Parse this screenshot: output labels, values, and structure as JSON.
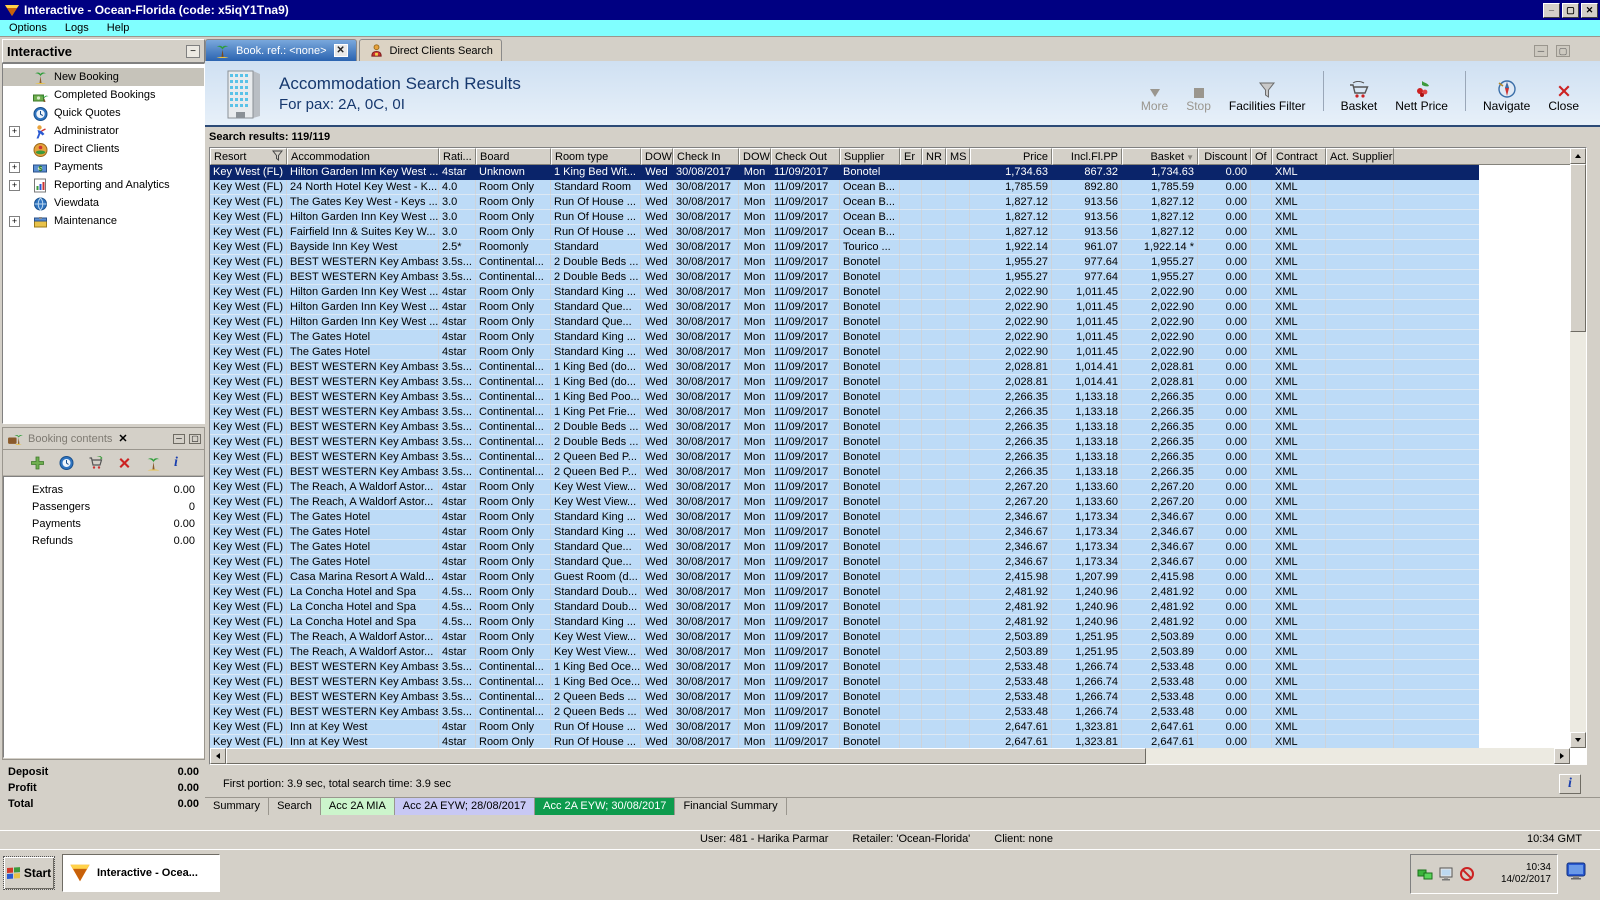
{
  "window": {
    "title": "Interactive - Ocean-Florida (code: x5iqY1Tna9)",
    "menus": [
      "Options",
      "Logs",
      "Help"
    ]
  },
  "sidebar": {
    "title": "Interactive",
    "items": [
      {
        "label": "New Booking",
        "icon": "palm-tree",
        "expandable": false,
        "selected": true
      },
      {
        "label": "Completed Bookings",
        "icon": "completed-bookings",
        "expandable": false,
        "selected": false
      },
      {
        "label": "Quick Quotes",
        "icon": "clock-globe",
        "expandable": false,
        "selected": false
      },
      {
        "label": "Administrator",
        "icon": "administrator",
        "expandable": true,
        "selected": false
      },
      {
        "label": "Direct Clients",
        "icon": "direct-clients",
        "expandable": false,
        "selected": false
      },
      {
        "label": "Payments",
        "icon": "payments",
        "expandable": true,
        "selected": false
      },
      {
        "label": "Reporting and Analytics",
        "icon": "report",
        "expandable": true,
        "selected": false
      },
      {
        "label": "Viewdata",
        "icon": "viewdata",
        "expandable": false,
        "selected": false
      },
      {
        "label": "Maintenance",
        "icon": "maintenance",
        "expandable": true,
        "selected": false
      }
    ]
  },
  "booking_contents": {
    "title": "Booking contents",
    "rows": [
      {
        "label": "Extras",
        "value": "0.00"
      },
      {
        "label": "Passengers",
        "value": "0"
      },
      {
        "label": "Payments",
        "value": "0.00"
      },
      {
        "label": "Refunds",
        "value": "0.00"
      }
    ]
  },
  "totals": [
    {
      "label": "Deposit",
      "value": "0.00"
    },
    {
      "label": "Profit",
      "value": "0.00"
    },
    {
      "label": "Total",
      "value": "0.00"
    }
  ],
  "tabs": [
    {
      "label": "Book. ref.: <none>",
      "active": true
    },
    {
      "label": "Direct Clients Search",
      "active": false
    }
  ],
  "header": {
    "title": "Accommodation Search Results",
    "subtitle": "For pax: 2A, 0C, 0I"
  },
  "toolbar": [
    {
      "label": "More",
      "disabled": true
    },
    {
      "label": "Stop",
      "disabled": true
    },
    {
      "label": "Facilities Filter",
      "disabled": false
    },
    {
      "label": "Basket",
      "disabled": false
    },
    {
      "label": "Nett Price",
      "disabled": false
    },
    {
      "label": "Navigate",
      "disabled": false
    },
    {
      "label": "Close",
      "disabled": false
    }
  ],
  "results": {
    "summary": "Search results: 119/119",
    "columns": [
      "Resort",
      "Accommodation",
      "Rati...",
      "Board",
      "Room type",
      "DOW",
      "Check In",
      "DOW",
      "Check Out",
      "Supplier",
      "Er",
      "NR",
      "MS",
      "Price",
      "Incl.Fl.PP",
      "Basket",
      "Discount",
      "Of",
      "Contract",
      "Act. Supplier"
    ],
    "row_defaults": {
      "resort": "Key West (FL)",
      "dow_in": "Wed",
      "check_in": "30/08/2017",
      "dow_out": "Mon",
      "check_out": "11/09/2017",
      "er": "",
      "nr": "",
      "ms": "",
      "discount": "0.00",
      "of": "",
      "contract": "XML",
      "act_supplier": ""
    },
    "selected_row": 0,
    "rows": [
      {
        "accommodation": "Hilton Garden Inn Key West ...",
        "rating": "4star",
        "board": "Unknown",
        "room_type": "1 King Bed Wit...",
        "supplier": "Bonotel",
        "price": "1,734.63",
        "incl_fl_pp": "867.32",
        "basket": "1,734.63"
      },
      {
        "accommodation": "24 North Hotel Key West - K...",
        "rating": "4.0",
        "board": "Room Only",
        "room_type": "Standard Room",
        "supplier": "Ocean B...",
        "price": "1,785.59",
        "incl_fl_pp": "892.80",
        "basket": "1,785.59"
      },
      {
        "accommodation": "The Gates Key West - Keys ...",
        "rating": "3.0",
        "board": "Room Only",
        "room_type": "Run Of House ...",
        "supplier": "Ocean B...",
        "price": "1,827.12",
        "incl_fl_pp": "913.56",
        "basket": "1,827.12"
      },
      {
        "accommodation": "Hilton Garden Inn Key West ...",
        "rating": "3.0",
        "board": "Room Only",
        "room_type": "Run Of House ...",
        "supplier": "Ocean B...",
        "price": "1,827.12",
        "incl_fl_pp": "913.56",
        "basket": "1,827.12"
      },
      {
        "accommodation": "Fairfield Inn & Suites Key W...",
        "rating": "3.0",
        "board": "Room Only",
        "room_type": "Run Of House ...",
        "supplier": "Ocean B...",
        "price": "1,827.12",
        "incl_fl_pp": "913.56",
        "basket": "1,827.12"
      },
      {
        "accommodation": "Bayside Inn Key West",
        "rating": "2.5*",
        "board": "Roomonly",
        "room_type": "Standard",
        "supplier": "Tourico ...",
        "price": "1,922.14",
        "incl_fl_pp": "961.07",
        "basket": "1,922.14 *"
      },
      {
        "accommodation": "BEST WESTERN Key Ambass...",
        "rating": "3.5s...",
        "board": "Continental...",
        "room_type": "2 Double Beds ...",
        "supplier": "Bonotel",
        "price": "1,955.27",
        "incl_fl_pp": "977.64",
        "basket": "1,955.27"
      },
      {
        "accommodation": "BEST WESTERN Key Ambass...",
        "rating": "3.5s...",
        "board": "Continental...",
        "room_type": "2 Double Beds ...",
        "supplier": "Bonotel",
        "price": "1,955.27",
        "incl_fl_pp": "977.64",
        "basket": "1,955.27"
      },
      {
        "accommodation": "Hilton Garden Inn Key West ...",
        "rating": "4star",
        "board": "Room Only",
        "room_type": "Standard King ...",
        "supplier": "Bonotel",
        "price": "2,022.90",
        "incl_fl_pp": "1,011.45",
        "basket": "2,022.90"
      },
      {
        "accommodation": "Hilton Garden Inn Key West ...",
        "rating": "4star",
        "board": "Room Only",
        "room_type": "Standard Que...",
        "supplier": "Bonotel",
        "price": "2,022.90",
        "incl_fl_pp": "1,011.45",
        "basket": "2,022.90"
      },
      {
        "accommodation": "Hilton Garden Inn Key West ...",
        "rating": "4star",
        "board": "Room Only",
        "room_type": "Standard Que...",
        "supplier": "Bonotel",
        "price": "2,022.90",
        "incl_fl_pp": "1,011.45",
        "basket": "2,022.90"
      },
      {
        "accommodation": "The Gates Hotel",
        "rating": "4star",
        "board": "Room Only",
        "room_type": "Standard King ...",
        "supplier": "Bonotel",
        "price": "2,022.90",
        "incl_fl_pp": "1,011.45",
        "basket": "2,022.90"
      },
      {
        "accommodation": "The Gates Hotel",
        "rating": "4star",
        "board": "Room Only",
        "room_type": "Standard King ...",
        "supplier": "Bonotel",
        "price": "2,022.90",
        "incl_fl_pp": "1,011.45",
        "basket": "2,022.90"
      },
      {
        "accommodation": "BEST WESTERN Key Ambass...",
        "rating": "3.5s...",
        "board": "Continental...",
        "room_type": "1 King Bed (do...",
        "supplier": "Bonotel",
        "price": "2,028.81",
        "incl_fl_pp": "1,014.41",
        "basket": "2,028.81"
      },
      {
        "accommodation": "BEST WESTERN Key Ambass...",
        "rating": "3.5s...",
        "board": "Continental...",
        "room_type": "1 King Bed (do...",
        "supplier": "Bonotel",
        "price": "2,028.81",
        "incl_fl_pp": "1,014.41",
        "basket": "2,028.81"
      },
      {
        "accommodation": "BEST WESTERN Key Ambass...",
        "rating": "3.5s...",
        "board": "Continental...",
        "room_type": "1 King Bed Poo...",
        "supplier": "Bonotel",
        "price": "2,266.35",
        "incl_fl_pp": "1,133.18",
        "basket": "2,266.35"
      },
      {
        "accommodation": "BEST WESTERN Key Ambass...",
        "rating": "3.5s...",
        "board": "Continental...",
        "room_type": "1 King Pet Frie...",
        "supplier": "Bonotel",
        "price": "2,266.35",
        "incl_fl_pp": "1,133.18",
        "basket": "2,266.35"
      },
      {
        "accommodation": "BEST WESTERN Key Ambass...",
        "rating": "3.5s...",
        "board": "Continental...",
        "room_type": "2 Double Beds ...",
        "supplier": "Bonotel",
        "price": "2,266.35",
        "incl_fl_pp": "1,133.18",
        "basket": "2,266.35"
      },
      {
        "accommodation": "BEST WESTERN Key Ambass...",
        "rating": "3.5s...",
        "board": "Continental...",
        "room_type": "2 Double Beds ...",
        "supplier": "Bonotel",
        "price": "2,266.35",
        "incl_fl_pp": "1,133.18",
        "basket": "2,266.35"
      },
      {
        "accommodation": "BEST WESTERN Key Ambass...",
        "rating": "3.5s...",
        "board": "Continental...",
        "room_type": "2 Queen Bed P...",
        "supplier": "Bonotel",
        "price": "2,266.35",
        "incl_fl_pp": "1,133.18",
        "basket": "2,266.35"
      },
      {
        "accommodation": "BEST WESTERN Key Ambass...",
        "rating": "3.5s...",
        "board": "Continental...",
        "room_type": "2 Queen Bed P...",
        "supplier": "Bonotel",
        "price": "2,266.35",
        "incl_fl_pp": "1,133.18",
        "basket": "2,266.35"
      },
      {
        "accommodation": "The Reach, A Waldorf Astor...",
        "rating": "4star",
        "board": "Room Only",
        "room_type": "Key West View...",
        "supplier": "Bonotel",
        "price": "2,267.20",
        "incl_fl_pp": "1,133.60",
        "basket": "2,267.20"
      },
      {
        "accommodation": "The Reach, A Waldorf Astor...",
        "rating": "4star",
        "board": "Room Only",
        "room_type": "Key West View...",
        "supplier": "Bonotel",
        "price": "2,267.20",
        "incl_fl_pp": "1,133.60",
        "basket": "2,267.20"
      },
      {
        "accommodation": "The Gates Hotel",
        "rating": "4star",
        "board": "Room Only",
        "room_type": "Standard King ...",
        "supplier": "Bonotel",
        "price": "2,346.67",
        "incl_fl_pp": "1,173.34",
        "basket": "2,346.67"
      },
      {
        "accommodation": "The Gates Hotel",
        "rating": "4star",
        "board": "Room Only",
        "room_type": "Standard King ...",
        "supplier": "Bonotel",
        "price": "2,346.67",
        "incl_fl_pp": "1,173.34",
        "basket": "2,346.67"
      },
      {
        "accommodation": "The Gates Hotel",
        "rating": "4star",
        "board": "Room Only",
        "room_type": "Standard Que...",
        "supplier": "Bonotel",
        "price": "2,346.67",
        "incl_fl_pp": "1,173.34",
        "basket": "2,346.67"
      },
      {
        "accommodation": "The Gates Hotel",
        "rating": "4star",
        "board": "Room Only",
        "room_type": "Standard Que...",
        "supplier": "Bonotel",
        "price": "2,346.67",
        "incl_fl_pp": "1,173.34",
        "basket": "2,346.67"
      },
      {
        "accommodation": "Casa Marina Resort A Wald...",
        "rating": "4star",
        "board": "Room Only",
        "room_type": "Guest Room (d...",
        "supplier": "Bonotel",
        "price": "2,415.98",
        "incl_fl_pp": "1,207.99",
        "basket": "2,415.98"
      },
      {
        "accommodation": "La Concha Hotel and Spa",
        "rating": "4.5s...",
        "board": "Room Only",
        "room_type": "Standard Doub...",
        "supplier": "Bonotel",
        "price": "2,481.92",
        "incl_fl_pp": "1,240.96",
        "basket": "2,481.92"
      },
      {
        "accommodation": "La Concha Hotel and Spa",
        "rating": "4.5s...",
        "board": "Room Only",
        "room_type": "Standard Doub...",
        "supplier": "Bonotel",
        "price": "2,481.92",
        "incl_fl_pp": "1,240.96",
        "basket": "2,481.92"
      },
      {
        "accommodation": "La Concha Hotel and Spa",
        "rating": "4.5s...",
        "board": "Room Only",
        "room_type": "Standard King ...",
        "supplier": "Bonotel",
        "price": "2,481.92",
        "incl_fl_pp": "1,240.96",
        "basket": "2,481.92"
      },
      {
        "accommodation": "The Reach, A Waldorf Astor...",
        "rating": "4star",
        "board": "Room Only",
        "room_type": "Key West View...",
        "supplier": "Bonotel",
        "price": "2,503.89",
        "incl_fl_pp": "1,251.95",
        "basket": "2,503.89"
      },
      {
        "accommodation": "The Reach, A Waldorf Astor...",
        "rating": "4star",
        "board": "Room Only",
        "room_type": "Key West View...",
        "supplier": "Bonotel",
        "price": "2,503.89",
        "incl_fl_pp": "1,251.95",
        "basket": "2,503.89"
      },
      {
        "accommodation": "BEST WESTERN Key Ambass...",
        "rating": "3.5s...",
        "board": "Continental...",
        "room_type": "1 King Bed Oce...",
        "supplier": "Bonotel",
        "price": "2,533.48",
        "incl_fl_pp": "1,266.74",
        "basket": "2,533.48"
      },
      {
        "accommodation": "BEST WESTERN Key Ambass...",
        "rating": "3.5s...",
        "board": "Continental...",
        "room_type": "1 King Bed Oce...",
        "supplier": "Bonotel",
        "price": "2,533.48",
        "incl_fl_pp": "1,266.74",
        "basket": "2,533.48"
      },
      {
        "accommodation": "BEST WESTERN Key Ambass...",
        "rating": "3.5s...",
        "board": "Continental...",
        "room_type": "2 Queen Beds ...",
        "supplier": "Bonotel",
        "price": "2,533.48",
        "incl_fl_pp": "1,266.74",
        "basket": "2,533.48"
      },
      {
        "accommodation": "BEST WESTERN Key Ambass...",
        "rating": "3.5s...",
        "board": "Continental...",
        "room_type": "2 Queen Beds ...",
        "supplier": "Bonotel",
        "price": "2,533.48",
        "incl_fl_pp": "1,266.74",
        "basket": "2,533.48"
      },
      {
        "accommodation": "Inn at Key West",
        "rating": "4star",
        "board": "Room Only",
        "room_type": "Run Of House ...",
        "supplier": "Bonotel",
        "price": "2,647.61",
        "incl_fl_pp": "1,323.81",
        "basket": "2,647.61"
      },
      {
        "accommodation": "Inn at Key West",
        "rating": "4star",
        "board": "Room Only",
        "room_type": "Run Of House ...",
        "supplier": "Bonotel",
        "price": "2,647.61",
        "incl_fl_pp": "1,323.81",
        "basket": "2,647.61"
      }
    ],
    "footer": "First portion: 3.9 sec, total search time: 3.9 sec"
  },
  "bottom_tabs": [
    {
      "label": "Summary",
      "bg": "#d4d0c8",
      "fg": "#000000",
      "active": false
    },
    {
      "label": "Search",
      "bg": "#d4d0c8",
      "fg": "#000000",
      "active": false
    },
    {
      "label": "Acc 2A MIA",
      "bg": "#ccf5cc",
      "fg": "#000000",
      "active": false
    },
    {
      "label": "Acc 2A EYW; 28/08/2017",
      "bg": "#c8c8f4",
      "fg": "#000000",
      "active": false
    },
    {
      "label": "Acc 2A EYW; 30/08/2017",
      "bg": "#0d9b4d",
      "fg": "#ffffff",
      "active": true
    },
    {
      "label": "Financial Summary",
      "bg": "#d4d0c8",
      "fg": "#000000",
      "active": false
    }
  ],
  "status_bar": {
    "user": "User: 481 - Harika Parmar",
    "retailer": "Retailer: 'Ocean-Florida'",
    "client": "Client: none",
    "time": "10:34 GMT"
  },
  "taskbar": {
    "start_label": "Start",
    "task_label": "Interactive - Ocea...",
    "tray_time": "10:34",
    "tray_date": "14/02/2017"
  },
  "colors": {
    "selected_row": "#0a246a",
    "row_blue": "#bddbf7",
    "titlebar": "#000082",
    "menubar": "#80ffff",
    "active_tab_green": "#0d9b4d"
  }
}
